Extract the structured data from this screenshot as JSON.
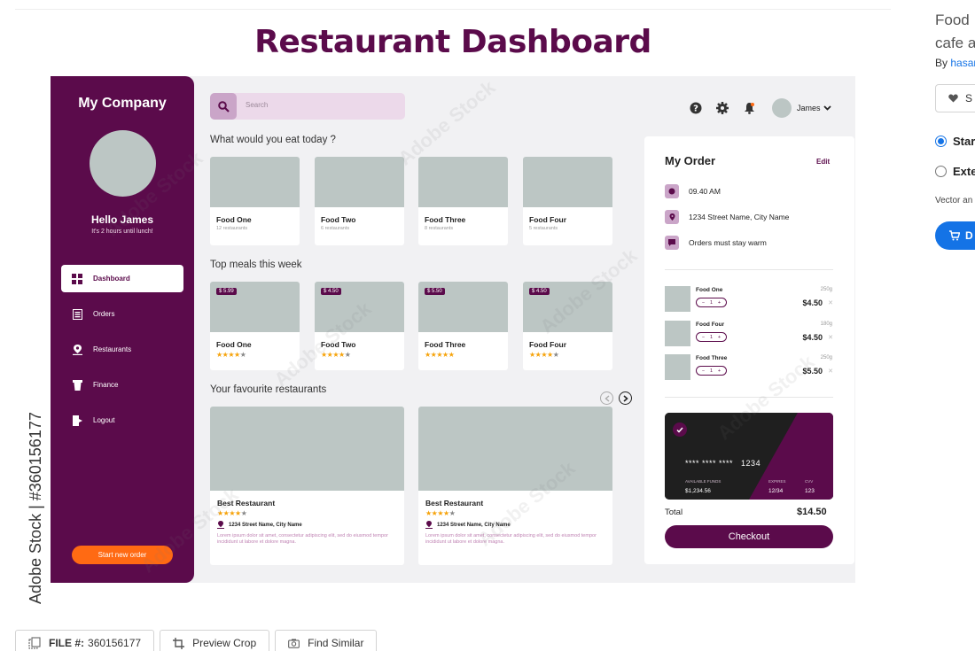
{
  "page_title": "Restaurant Dashboard",
  "sidebar": {
    "brand": "My Company",
    "greeting": "Hello James",
    "greeting_sub": "It's 2 hours until lunch!",
    "items": [
      {
        "label": "Dashboard",
        "icon": "grid-icon",
        "active": true
      },
      {
        "label": "Orders",
        "icon": "list-icon"
      },
      {
        "label": "Restaurants",
        "icon": "pin-icon"
      },
      {
        "label": "Finance",
        "icon": "cup-icon"
      },
      {
        "label": "Logout",
        "icon": "logout-icon"
      }
    ],
    "cta": "Start new order"
  },
  "topbar": {
    "search_placeholder": "Search",
    "user_name": "James"
  },
  "sections": {
    "eat_today": "What would you eat today ?",
    "top_meals": "Top meals this week",
    "fav_restaurants": "Your favourite restaurants"
  },
  "foods": [
    {
      "name": "Food One",
      "sub": "12 restaurants"
    },
    {
      "name": "Food Two",
      "sub": "6 restaurants"
    },
    {
      "name": "Food Three",
      "sub": "8 restaurants"
    },
    {
      "name": "Food Four",
      "sub": "5 restaurants"
    }
  ],
  "meals": [
    {
      "name": "Food One",
      "price": "$ 5.99",
      "rating": 4
    },
    {
      "name": "Food Two",
      "price": "$ 4.50",
      "rating": 4
    },
    {
      "name": "Food Three",
      "price": "$ 5.50",
      "rating": 5
    },
    {
      "name": "Food Four",
      "price": "$ 4.50",
      "rating": 4
    }
  ],
  "restaurants": [
    {
      "name": "Best Restaurant",
      "rating": 4,
      "address": "1234 Street Name, City Name",
      "desc": "Lorem ipsum dolor sit amet, consectetur adipiscing elit, sed do eiusmod tempor incididunt ut labore et dolore magna."
    },
    {
      "name": "Best Restaurant",
      "rating": 4,
      "address": "1234 Street Name, City Name",
      "desc": "Lorem ipsum dolor sit amet, consectetur adipiscing elit, sed do eiusmod tempor incididunt ut labore et dolore magna."
    }
  ],
  "order": {
    "title": "My Order",
    "edit": "Edit",
    "time": "09.40 AM",
    "address": "1234 Street Name, City Name",
    "note": "Orders must stay warm",
    "items": [
      {
        "name": "Food One",
        "qty": "1",
        "weight": "250g",
        "price": "$4.50"
      },
      {
        "name": "Food Four",
        "qty": "1",
        "weight": "180g",
        "price": "$4.50"
      },
      {
        "name": "Food Three",
        "qty": "1",
        "weight": "250g",
        "price": "$5.50"
      }
    ],
    "card": {
      "number_masked": "**** **** ****",
      "number_last": "1234",
      "funds_label": "AVAILABLE FUNDS",
      "funds": "$1,234.56",
      "expires_label": "EXPIRES",
      "expires": "12/34",
      "cvv_label": "CVV",
      "cvv": "123"
    },
    "total_label": "Total",
    "total": "$14.50",
    "checkout": "Checkout"
  },
  "watermark": {
    "id_text": "Adobe Stock | #360156177",
    "text": "Adobe Stock"
  },
  "stock_panel": {
    "title_line1": "Food",
    "title_line2": "cafe a",
    "by_prefix": "By",
    "by_name": "hasar",
    "save": "S",
    "license_standard": "Star",
    "license_extended": "Exte",
    "type": "Vector an",
    "download": "D"
  },
  "toolbar": {
    "file_label": "FILE #:",
    "file_id": "360156177",
    "preview_crop": "Preview Crop",
    "find_similar": "Find Similar"
  },
  "colors": {
    "brand": "#5b0b4b",
    "accent": "#ff6a13",
    "placeholder": "#bcc6c4",
    "link": "#1473e6"
  }
}
